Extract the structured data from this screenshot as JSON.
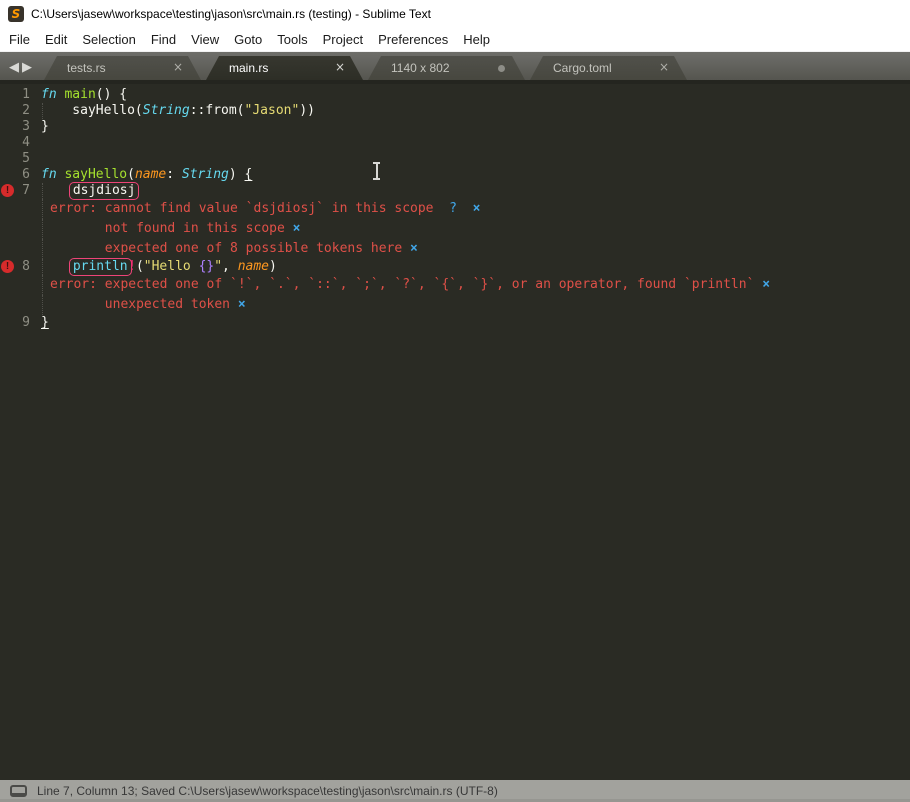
{
  "window": {
    "title": "C:\\Users\\jasew\\workspace\\testing\\jason\\src\\main.rs (testing) - Sublime Text",
    "app_icon_glyph": "S"
  },
  "menu": {
    "items": [
      "File",
      "Edit",
      "Selection",
      "Find",
      "View",
      "Goto",
      "Tools",
      "Project",
      "Preferences",
      "Help"
    ]
  },
  "tabs": {
    "nav": {
      "back": "◀",
      "forward": "▶"
    },
    "items": [
      {
        "label": "tests.rs",
        "state": "inactive",
        "indicator": "close",
        "close_glyph": "×"
      },
      {
        "label": "main.rs",
        "state": "active",
        "indicator": "close",
        "close_glyph": "×"
      },
      {
        "label": "1140 x 802",
        "state": "inactive",
        "indicator": "dot"
      },
      {
        "label": "Cargo.toml",
        "state": "inactive",
        "indicator": "close",
        "close_glyph": "×"
      }
    ]
  },
  "editor": {
    "rows": [
      {
        "type": "code",
        "num": "1",
        "segments": [
          [
            "fn ",
            "kw"
          ],
          [
            "main",
            "fn"
          ],
          [
            "() {",
            "plain"
          ]
        ]
      },
      {
        "type": "code",
        "num": "2",
        "guide": true,
        "segments": [
          [
            "    sayHello(",
            "plain"
          ],
          [
            "String",
            "kw"
          ],
          [
            "::from(",
            "plain"
          ],
          [
            "\"Jason\"",
            "str"
          ],
          [
            "))",
            "plain"
          ]
        ]
      },
      {
        "type": "code",
        "num": "3",
        "segments": [
          [
            "}",
            "plain"
          ]
        ]
      },
      {
        "type": "code",
        "num": "4",
        "segments": []
      },
      {
        "type": "code",
        "num": "5",
        "segments": []
      },
      {
        "type": "code",
        "num": "6",
        "segments": [
          [
            "fn ",
            "kw"
          ],
          [
            "sayHello",
            "fn"
          ],
          [
            "(",
            "plain"
          ],
          [
            "name",
            "param"
          ],
          [
            ": ",
            "plain"
          ],
          [
            "String",
            "kw"
          ],
          [
            ") ",
            "plain"
          ],
          [
            "{",
            "plain uline"
          ]
        ]
      },
      {
        "type": "code",
        "num": "7",
        "icon": true,
        "guide": true,
        "segments": [
          [
            "    ",
            "plain"
          ],
          [
            "dsjdiosj",
            "plain boxed"
          ]
        ]
      },
      {
        "type": "error",
        "guide": true,
        "segments": [
          [
            "error: cannot find value `dsjdiosj` in this scope  ",
            "err"
          ],
          [
            "?",
            "help"
          ],
          [
            "  ",
            "plain"
          ],
          [
            "×",
            "close"
          ]
        ]
      },
      {
        "type": "error",
        "guide": true,
        "segments": [
          [
            "       not found in this scope ",
            "err"
          ],
          [
            "×",
            "close"
          ]
        ]
      },
      {
        "type": "error",
        "guide": true,
        "segments": [
          [
            "       expected one of 8 possible tokens here ",
            "err"
          ],
          [
            "×",
            "close"
          ]
        ]
      },
      {
        "type": "code",
        "num": "8",
        "icon": true,
        "guide": true,
        "segments": [
          [
            "    ",
            "plain"
          ],
          [
            "println",
            "kw boxed"
          ],
          [
            "!",
            "pink"
          ],
          [
            "(",
            "plain"
          ],
          [
            "\"Hello ",
            "str"
          ],
          [
            "{}",
            "ph"
          ],
          [
            "\"",
            "str"
          ],
          [
            ", ",
            "plain"
          ],
          [
            "name",
            "param"
          ],
          [
            ")",
            "plain"
          ]
        ]
      },
      {
        "type": "error",
        "guide": true,
        "segments": [
          [
            "error: expected one of `!`, `.`, `::`, `;`, `?`, `{`, `}`, or an operator, found `println` ",
            "err"
          ],
          [
            "×",
            "close"
          ]
        ]
      },
      {
        "type": "error",
        "guide": true,
        "segments": [
          [
            "       unexpected token ",
            "err"
          ],
          [
            "×",
            "close"
          ]
        ]
      },
      {
        "type": "code",
        "num": "9",
        "segments": [
          [
            "}",
            "plain uline"
          ]
        ]
      }
    ]
  },
  "statusbar": {
    "text": "Line 7, Column 13; Saved C:\\Users\\jasew\\workspace\\testing\\jason\\src\\main.rs (UTF-8)"
  },
  "colors": {
    "editor_bg": "#2a2b24",
    "fg": "#f8f8f2",
    "syntax_keyword": "#66d9ef",
    "syntax_function": "#a6e22e",
    "syntax_param": "#fd971f",
    "syntax_string": "#e6db74",
    "syntax_placeholder": "#ae81ff",
    "syntax_pink": "#f92672",
    "error_text": "#df5048",
    "error_box": "#ee4478",
    "error_icon": "#d62b2b",
    "annotation_link": "#41a6e8",
    "sublime_orange": "#ff9800"
  }
}
